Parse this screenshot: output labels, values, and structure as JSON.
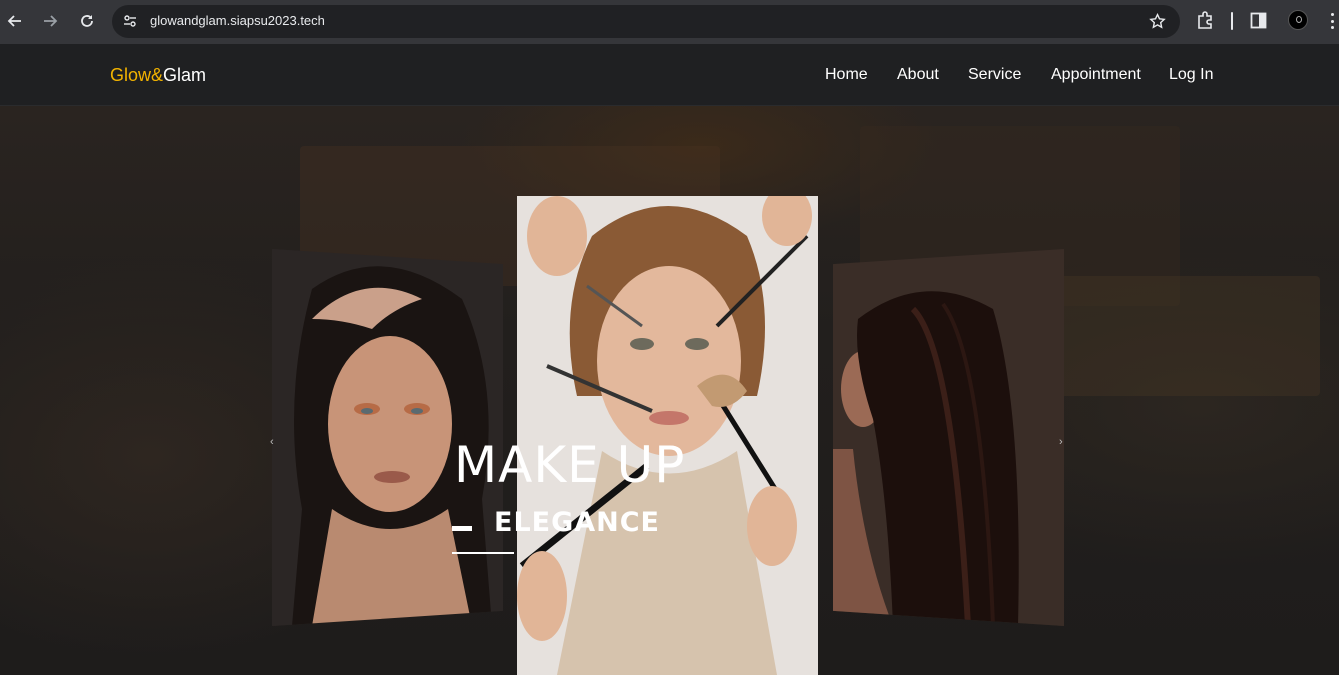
{
  "browser": {
    "url": "glowandglam.siapsu2023.tech"
  },
  "site": {
    "logo_part1": "Glow&",
    "logo_part2": "Glam",
    "nav": [
      "Home",
      "About",
      "Service",
      "Appointment",
      "Log In"
    ]
  },
  "hero": {
    "title": "MAKE UP",
    "subtitle": "ELEGANCE",
    "prev_arrow": "‹",
    "next_arrow": "›"
  },
  "colors": {
    "logo_accent": "#f2b300",
    "navbar_bg": "#1f2022",
    "text": "#ffffff"
  }
}
